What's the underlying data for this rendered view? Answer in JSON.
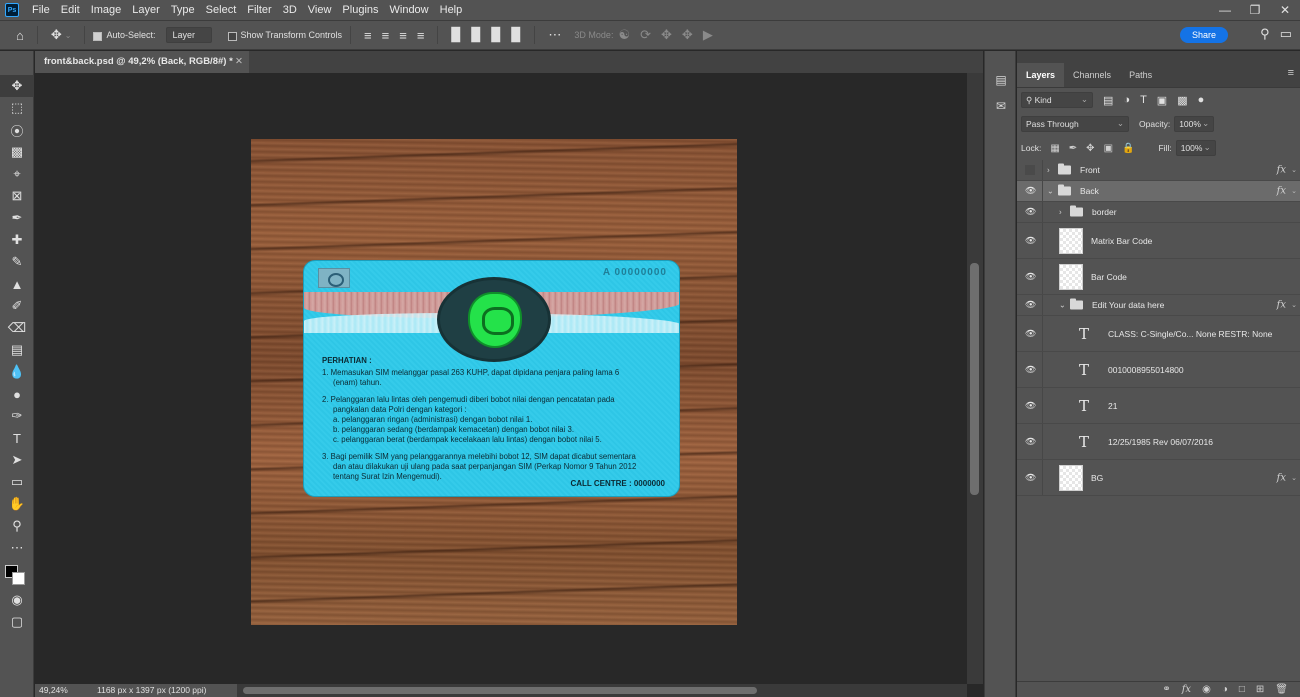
{
  "app": {
    "logo_text": "Ps"
  },
  "menu": [
    "File",
    "Edit",
    "Image",
    "Layer",
    "Type",
    "Select",
    "Filter",
    "3D",
    "View",
    "Plugins",
    "Window",
    "Help"
  ],
  "options_bar": {
    "auto_select_label": "Auto-Select:",
    "auto_select_checked": true,
    "auto_select_target": "Layer",
    "show_transform_label": "Show Transform Controls",
    "show_transform_checked": false,
    "mode_3d_label": "3D Mode:",
    "share_label": "Share"
  },
  "document": {
    "tab_title": "front&back.psd @ 49,2% (Back, RGB/8#) *",
    "zoom": "49,24%",
    "doc_info": "1168 px x 1397 px (1200 ppi)"
  },
  "card": {
    "serial": "A   00000000",
    "heading": "PERHATIAN :",
    "items": [
      "1. Memasukan SIM melanggar pasal 263 KUHP, dapat dipidana penjara paling lama 6",
      "(enam) tahun.",
      "2. Pelanggaran lalu lintas oleh pengemudi diberi bobot nilai dengan pencatatan pada",
      "pangkalan data Polri dengan kategori :",
      "a. pelanggaran ringan (administrasi) dengan bobot nilai 1.",
      "b. pelanggaran sedang (berdampak kemacetan) dengan bobot nilai 3.",
      "c. pelanggaran berat (berdampak kecelakaan lalu lintas) dengan bobot nilai 5.",
      "3. Bagi pemilik SIM yang pelanggarannya melebihi bobot 12, SIM dapat dicabut sementara",
      "dan atau dilakukan uji ulang pada saat perpanjangan SIM (Perkap Nomor 9 Tahun 2012",
      "tentang Surat Izin Mengemudi)."
    ],
    "footer": "CALL CENTRE : 0000000"
  },
  "panel": {
    "tabs": [
      "Layers",
      "Channels",
      "Paths"
    ],
    "active_tab": "Layers",
    "filter_kind": "Kind",
    "blend_mode": "Pass Through",
    "opacity_label": "Opacity:",
    "opacity": "100%",
    "lock_label": "Lock:",
    "fill_label": "Fill:",
    "fill": "100%",
    "layers": [
      {
        "name": "Front",
        "kind": "group",
        "visible": false,
        "fx": true,
        "indent": 0,
        "expanded": false
      },
      {
        "name": "Back",
        "kind": "group",
        "visible": true,
        "fx": true,
        "indent": 0,
        "expanded": true,
        "selected": true
      },
      {
        "name": "border",
        "kind": "group",
        "visible": true,
        "fx": false,
        "indent": 1,
        "expanded": false
      },
      {
        "name": "Matrix Bar Code",
        "kind": "pixel",
        "visible": true,
        "fx": false,
        "indent": 1
      },
      {
        "name": "Bar Code",
        "kind": "pixel",
        "visible": true,
        "fx": false,
        "indent": 1
      },
      {
        "name": "Edit Your data here",
        "kind": "group",
        "visible": true,
        "fx": true,
        "indent": 1,
        "expanded": true
      },
      {
        "name": "CLASS: C-Single/Co... None RESTR: None",
        "kind": "text",
        "visible": true,
        "fx": false,
        "indent": 2
      },
      {
        "name": "0010008955014800",
        "kind": "text",
        "visible": true,
        "fx": false,
        "indent": 2
      },
      {
        "name": "21",
        "kind": "text",
        "visible": true,
        "fx": false,
        "indent": 2
      },
      {
        "name": "12/25/1985 Rev 06/07/2016",
        "kind": "text",
        "visible": true,
        "fx": false,
        "indent": 2
      },
      {
        "name": "BG",
        "kind": "pixel",
        "visible": true,
        "fx": true,
        "indent": 1
      }
    ]
  },
  "colors": {
    "ui_bg": "#535353",
    "canvas_bg": "#282828",
    "accent": "#1473e6",
    "card_cyan": "#2ec6e6",
    "emblem_green": "#24e24a"
  }
}
